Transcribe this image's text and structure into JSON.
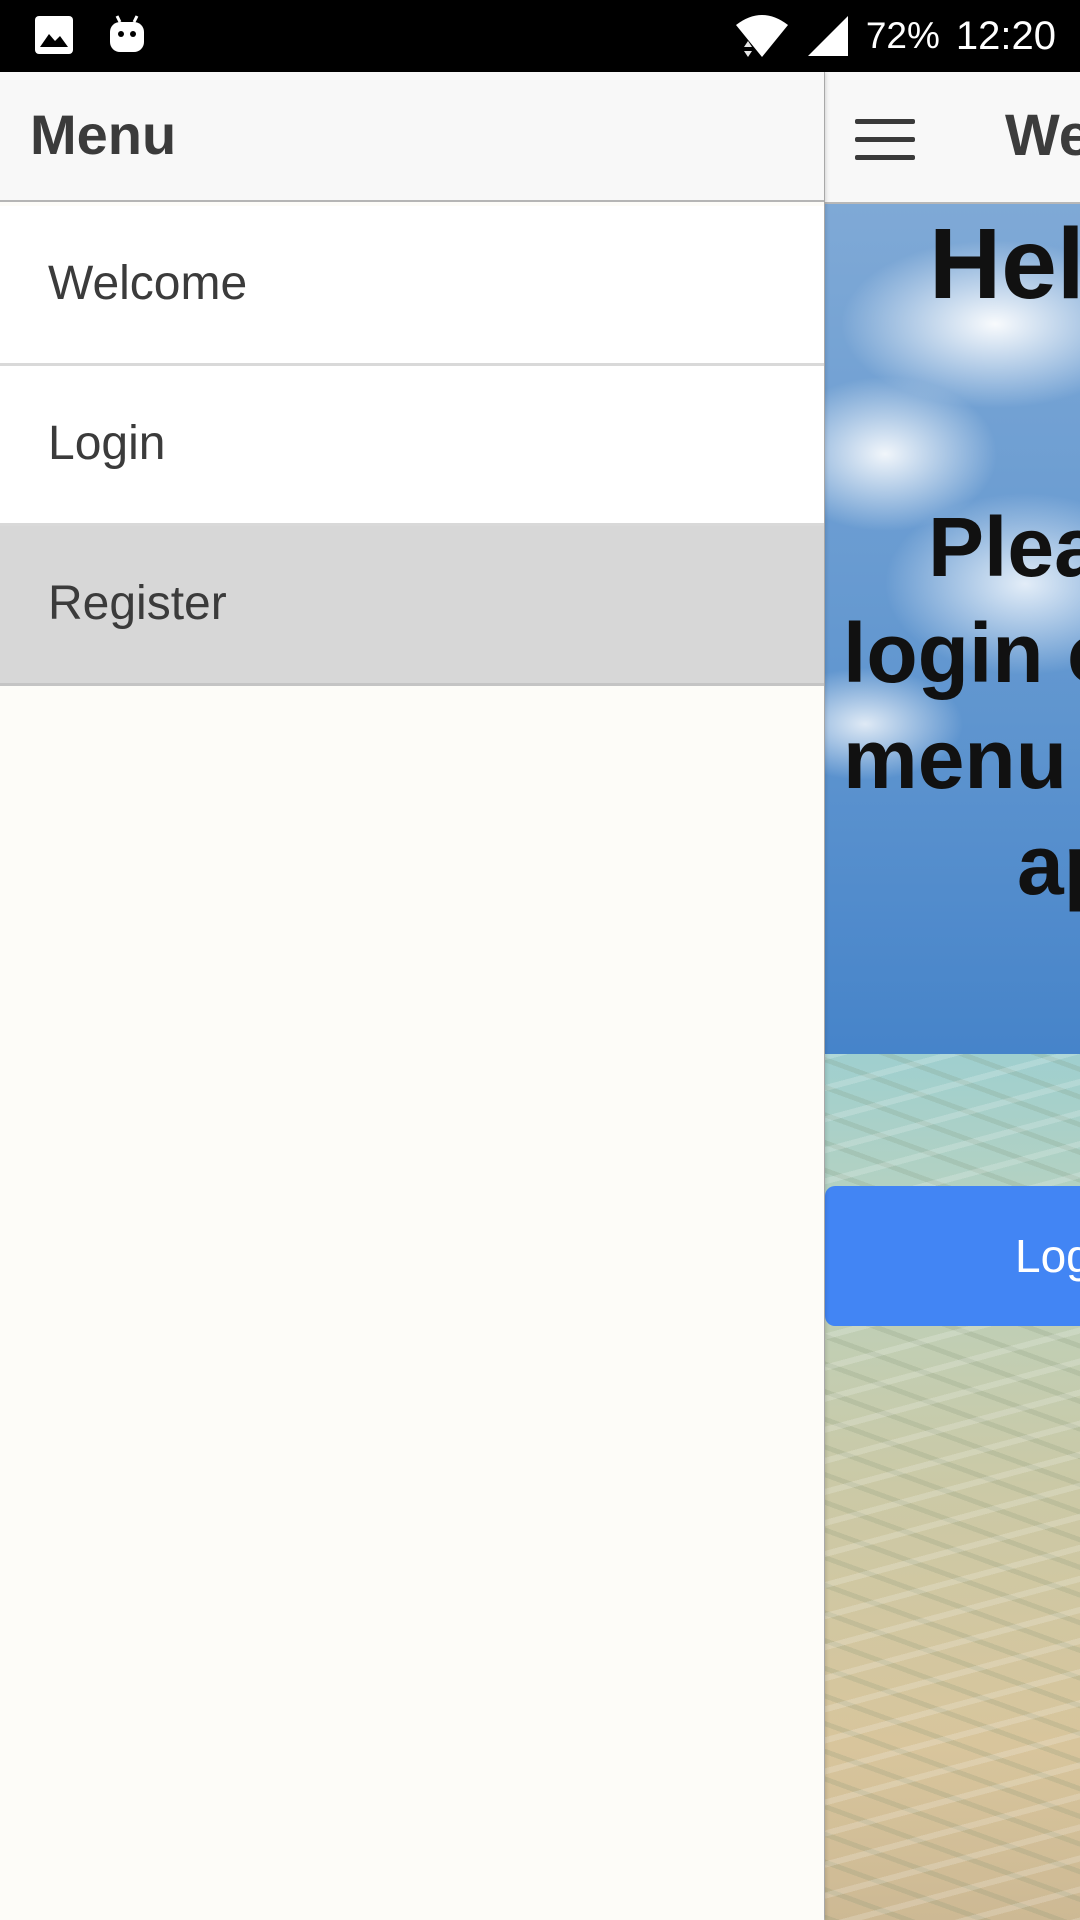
{
  "status_bar": {
    "left_icons": [
      "image-icon",
      "android-icon"
    ],
    "battery": "72%",
    "time": "12:20",
    "right_icons": [
      "wifi-icon",
      "cell-signal-icon"
    ]
  },
  "drawer": {
    "title": "Menu",
    "items": [
      {
        "label": "Welcome",
        "active": false
      },
      {
        "label": "Login",
        "active": false
      },
      {
        "label": "Register",
        "active": true
      }
    ]
  },
  "content": {
    "header_title": "We",
    "heading": "Hel",
    "message_lines": [
      "Plea",
      "login o",
      "menu",
      "ap"
    ],
    "login_button": "Log"
  },
  "colors": {
    "primary_button": "#4285f4",
    "active_item_bg": "#d7d7d7",
    "drawer_bg": "#fdfcf8",
    "header_bg": "#f8f8f8"
  }
}
